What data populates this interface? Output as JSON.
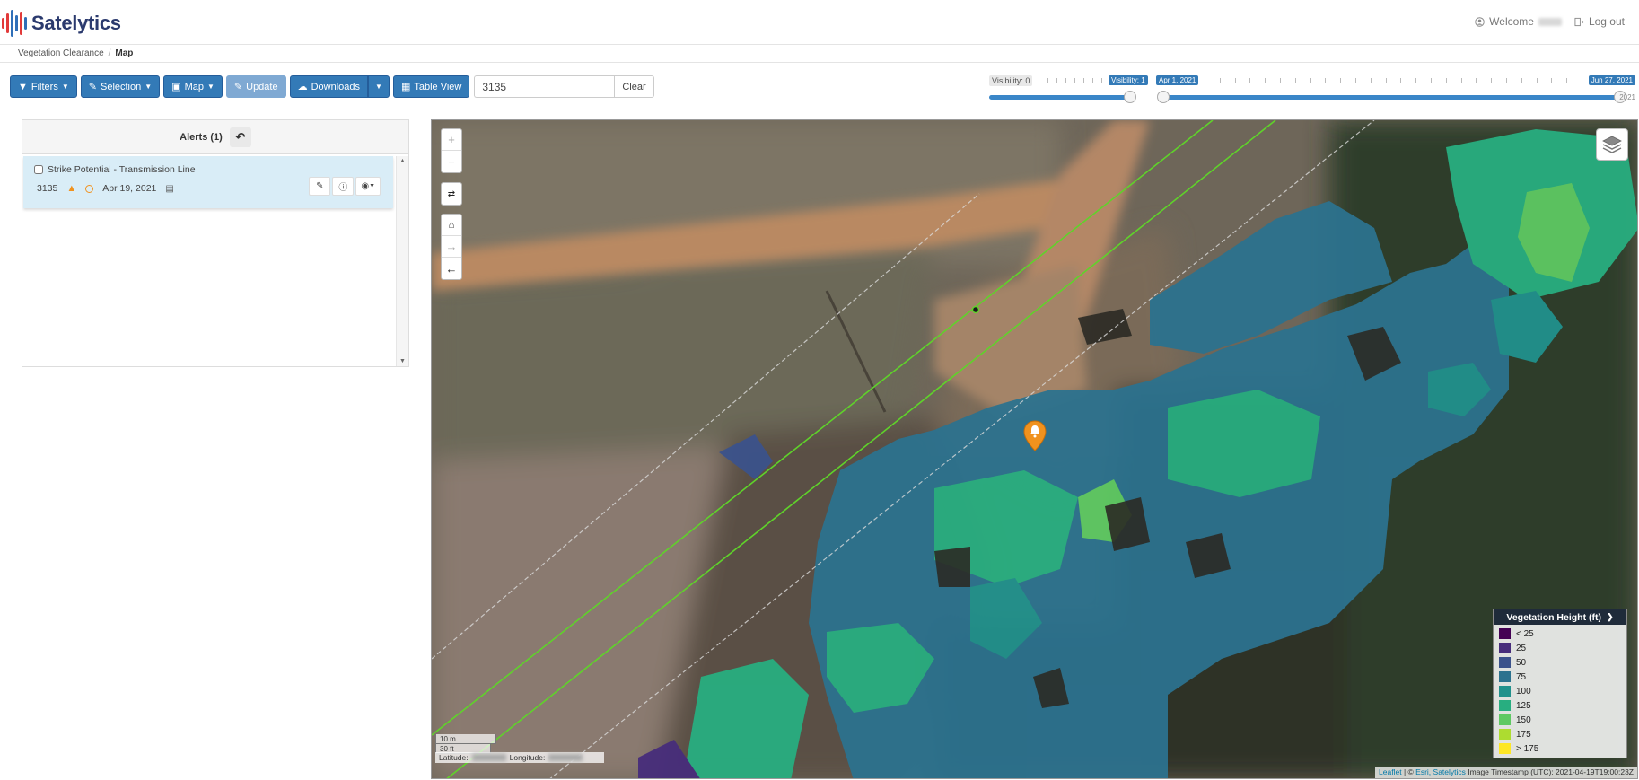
{
  "app": {
    "logo_text": "Satelytics",
    "welcome_label": "Welcome",
    "logout_label": "Log out"
  },
  "breadcrumb": {
    "items": [
      "Vegetation Clearance",
      "Map"
    ],
    "separator": "/"
  },
  "toolbar": {
    "filters_label": "Filters",
    "selection_label": "Selection",
    "map_label": "Map",
    "update_label": "Update",
    "downloads_label": "Downloads",
    "table_view_label": "Table View",
    "search_value": "3135",
    "clear_label": "Clear"
  },
  "sliders": {
    "visibility_min_label": "Visibility: 0",
    "visibility_value_label": "Visibility: 1",
    "date_start_label": "Apr 1, 2021",
    "date_end_label": "Jun 27, 2021",
    "year_label": "2021"
  },
  "alerts": {
    "header_label": "Alerts (1)",
    "items": [
      {
        "title": "Strike Potential - Transmission Line",
        "id": "3135",
        "date": "Apr 19, 2021"
      }
    ]
  },
  "map": {
    "scale_m": "10 m",
    "scale_ft": "30 ft",
    "latitude_label": "Latitude:",
    "longitude_label": "Longitude:",
    "attribution_leaflet": "Leaflet",
    "attribution_sep": "| ©",
    "attribution_esri": "Esri,",
    "attribution_satelytics": "Satelytics",
    "attribution_timestamp": "Image Timestamp (UTC): 2021-04-19T19:00:23Z",
    "colors": {
      "power_line": "#5fd32a",
      "alert_marker": "#f0921e"
    }
  },
  "legend": {
    "title": "Vegetation Height (ft)",
    "items": [
      {
        "label": "< 25",
        "color": "#440154"
      },
      {
        "label": "25",
        "color": "#472d7b"
      },
      {
        "label": "50",
        "color": "#3b528b"
      },
      {
        "label": "75",
        "color": "#2c728e"
      },
      {
        "label": "100",
        "color": "#21918c"
      },
      {
        "label": "125",
        "color": "#28ae80"
      },
      {
        "label": "150",
        "color": "#5ec962"
      },
      {
        "label": "175",
        "color": "#addc30"
      },
      {
        "label": "> 175",
        "color": "#fde725"
      }
    ]
  }
}
